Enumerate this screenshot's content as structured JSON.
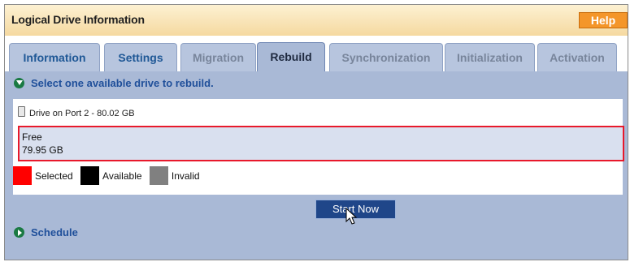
{
  "header": {
    "title": "Logical Drive Information",
    "help_label": "Help"
  },
  "tabs": [
    {
      "label": "Information",
      "state": "enabled"
    },
    {
      "label": "Settings",
      "state": "enabled"
    },
    {
      "label": "Migration",
      "state": "disabled"
    },
    {
      "label": "Rebuild",
      "state": "active"
    },
    {
      "label": "Synchronization",
      "state": "disabled"
    },
    {
      "label": "Initialization",
      "state": "disabled"
    },
    {
      "label": "Activation",
      "state": "disabled"
    }
  ],
  "instruction": "Select one available drive to rebuild.",
  "drive": {
    "title": "Drive on Port 2 - 80.02 GB",
    "segment_status": "Free",
    "segment_size": "79.95 GB"
  },
  "legend": {
    "selected_label": "Selected",
    "available_label": "Available",
    "invalid_label": "Invalid",
    "selected_color": "#ff0000",
    "available_color": "#000000",
    "invalid_color": "#808080"
  },
  "start_button_label": "Start Now",
  "schedule_label": "Schedule"
}
